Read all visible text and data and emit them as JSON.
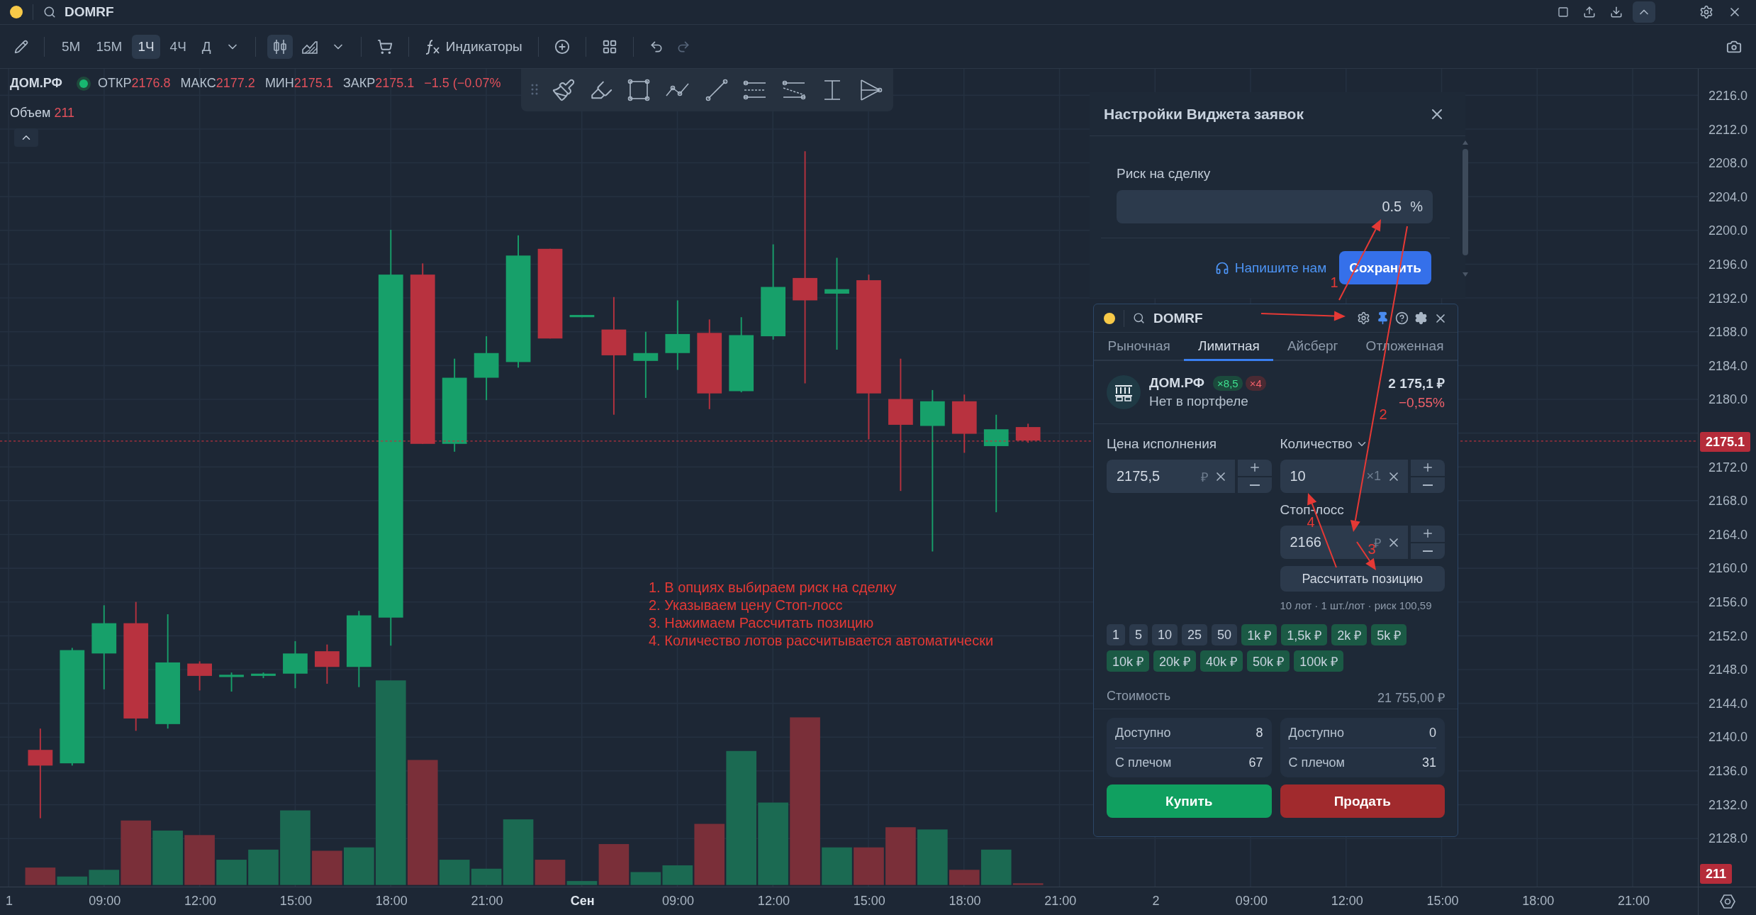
{
  "top_bar": {
    "search": "DOMRF"
  },
  "toolbar": {
    "timeframes": [
      {
        "label": "5M",
        "selected": false
      },
      {
        "label": "15M",
        "selected": false
      },
      {
        "label": "1Ч",
        "selected": true
      },
      {
        "label": "4Ч",
        "selected": false
      },
      {
        "label": "Д",
        "selected": false
      }
    ],
    "chart_types": [
      {
        "kind": "candles",
        "selected": true
      },
      {
        "kind": "area",
        "selected": false
      }
    ],
    "indicators": "Индикаторы",
    "history": [
      {
        "kind": "undo",
        "disabled": false
      },
      {
        "kind": "redo",
        "disabled": true
      }
    ]
  },
  "legend": {
    "symbol": "ДОМ.РФ",
    "fields": [
      {
        "label": "ОТКР",
        "value": "2176.8"
      },
      {
        "label": "МАКС",
        "value": "2177.2"
      },
      {
        "label": "МИН",
        "value": "2175.1"
      },
      {
        "label": "ЗАКР",
        "value": "2175.1"
      }
    ],
    "change": "−1.5 (−0.07%",
    "volume": {
      "label": "Объем",
      "value": "211"
    }
  },
  "price_axis": {
    "labels": [
      "2216.0",
      "2212.0",
      "2208.0",
      "2204.0",
      "2200.0",
      "2196.0",
      "2192.0",
      "2188.0",
      "2184.0",
      "2180.0",
      "2172.0",
      "2168.0",
      "2164.0",
      "2160.0",
      "2156.0",
      "2152.0",
      "2148.0",
      "2144.0",
      "2140.0",
      "2136.0",
      "2132.0",
      "2128.0"
    ],
    "last_price": "2175.1",
    "last_volume": "211"
  },
  "time_axis": {
    "labels": [
      {
        "label": "1",
        "kind": "time"
      },
      {
        "label": "09:00",
        "kind": "time"
      },
      {
        "label": "12:00",
        "kind": "time"
      },
      {
        "label": "15:00",
        "kind": "time"
      },
      {
        "label": "18:00",
        "kind": "time"
      },
      {
        "label": "21:00",
        "kind": "time"
      },
      {
        "label": "Сен",
        "kind": "date"
      },
      {
        "label": "09:00",
        "kind": "time"
      },
      {
        "label": "12:00",
        "kind": "time"
      },
      {
        "label": "15:00",
        "kind": "time"
      },
      {
        "label": "18:00",
        "kind": "time"
      },
      {
        "label": "21:00",
        "kind": "time"
      },
      {
        "label": "2",
        "kind": "time"
      },
      {
        "label": "09:00",
        "kind": "time"
      },
      {
        "label": "12:00",
        "kind": "time"
      },
      {
        "label": "15:00",
        "kind": "time"
      },
      {
        "label": "18:00",
        "kind": "time"
      },
      {
        "label": "21:00",
        "kind": "time"
      }
    ]
  },
  "annotations": {
    "steps": [
      "1. В опциях выбираем риск на сделку",
      "2. Указываем цену Стоп-лосс",
      "3. Нажимаем Рассчитать позицию",
      "4. Количество лотов рассчитывается автоматически"
    ],
    "markers": [
      "1",
      "2",
      "3",
      "4"
    ]
  },
  "settings_panel": {
    "title": "Настройки Виджета заявок",
    "risk_label": "Риск на сделку",
    "risk_value": "0.5",
    "risk_unit": "%",
    "contact_link": "Напишите нам",
    "save_button": "Сохранить"
  },
  "order_widget": {
    "search": "DOMRF",
    "tabs": [
      {
        "label": "Рыночная",
        "selected": false
      },
      {
        "label": "Лимитная",
        "selected": true
      },
      {
        "label": "Айсберг",
        "selected": false
      },
      {
        "label": "Отложенная",
        "selected": false
      }
    ],
    "instrument": {
      "name": "ДОМ.РФ",
      "badges": [
        {
          "label": "×8,5",
          "kind": "long"
        },
        {
          "label": "×4",
          "kind": "short"
        }
      ],
      "status": "Нет в портфеле",
      "price": "2 175,1 ₽",
      "change": "−0,55%"
    },
    "price_field": {
      "label": "Цена исполнения",
      "value": "2175,5",
      "unit": "₽"
    },
    "quantity_field": {
      "label": "Количество",
      "value": "10",
      "unit": "×1"
    },
    "stop_loss_field": {
      "label": "Стоп-лосс",
      "value": "2166",
      "unit": "₽"
    },
    "calc_button": "Рассчитать позицию",
    "calc_hint": "10 лот · 1 шт./лот · риск 100,59",
    "quick_amounts": [
      {
        "label": "1",
        "kind": "lots"
      },
      {
        "label": "5",
        "kind": "lots"
      },
      {
        "label": "10",
        "kind": "lots"
      },
      {
        "label": "25",
        "kind": "lots"
      },
      {
        "label": "50",
        "kind": "lots"
      },
      {
        "label": "1k ₽",
        "kind": "money"
      },
      {
        "label": "1,5k ₽",
        "kind": "money"
      },
      {
        "label": "2k ₽",
        "kind": "money"
      },
      {
        "label": "5k ₽",
        "kind": "money"
      },
      {
        "label": "10k ₽",
        "kind": "money"
      },
      {
        "label": "20k ₽",
        "kind": "money"
      },
      {
        "label": "40k ₽",
        "kind": "money"
      },
      {
        "label": "50k ₽",
        "kind": "money"
      },
      {
        "label": "100k ₽",
        "kind": "money"
      }
    ],
    "cost": {
      "label": "Стоимость",
      "value": "21 755,00 ₽"
    },
    "balances": [
      {
        "rows": [
          {
            "label": "Доступно",
            "value": "8"
          },
          {
            "label": "С плечом",
            "value": "67"
          }
        ]
      },
      {
        "rows": [
          {
            "label": "Доступно",
            "value": "0"
          },
          {
            "label": "С плечом",
            "value": "31"
          }
        ]
      }
    ],
    "buy_button": "Купить",
    "sell_button": "Продать"
  }
}
